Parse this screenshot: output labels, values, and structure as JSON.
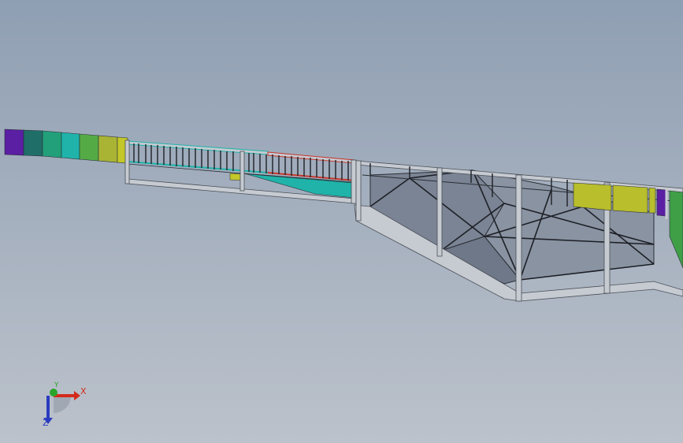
{
  "scene": {
    "background_top": "#8f9fb3",
    "background_bottom": "#bcc2cb",
    "frame_color": "#c6cad1",
    "frame_edge": "#4a4f57",
    "panel_fill": "#7b8494",
    "color_strip": [
      "#5a1fa3",
      "#1f6e67",
      "#21a07a",
      "#1fb3a9",
      "#54ab46",
      "#a9b435",
      "#c3c729"
    ],
    "accent_red": "#c8382c",
    "accent_teal": "#1fb3a9",
    "accent_yellow": "#b8be2c",
    "accent_purple": "#5a1fa3",
    "accent_green": "#3e9f47"
  },
  "triad": {
    "x_label": "X",
    "y_label": "Y",
    "z_label": "Z",
    "x_color": "#d42a1c",
    "y_color": "#2aa42a",
    "z_color": "#2a3bbf"
  }
}
